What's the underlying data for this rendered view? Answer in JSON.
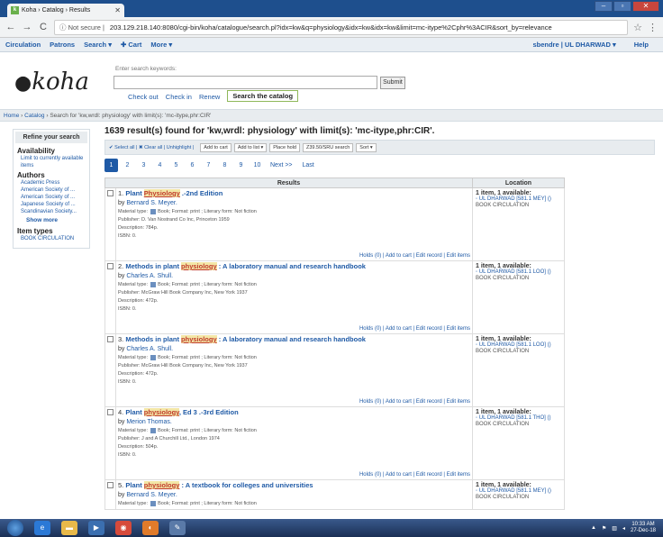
{
  "browser": {
    "tab_title": "Koha › Catalog › Results",
    "favicon_letter": "k",
    "security": "Not secure",
    "url": "203.129.218.140:8080/cgi-bin/koha/catalogue/search.pl?idx=kw&q=physiology&idx=kw&idx=kw&limit=mc-itype%2Cphr%3ACIR&sort_by=relevance"
  },
  "nav": {
    "items": [
      "Circulation",
      "Patrons",
      "Search ▾",
      "✚ Cart",
      "More ▾"
    ],
    "user": "sbendre | UL DHARWAD ▾",
    "help": "Help"
  },
  "header": {
    "logo": "koha",
    "search_label": "Enter search keywords:",
    "search_value": "",
    "submit": "Submit",
    "tabs": [
      "Check out",
      "Check in",
      "Renew",
      "Search the catalog"
    ]
  },
  "breadcrumb": {
    "home": "Home",
    "catalog": "Catalog",
    "current": "Search for 'kw,wrdl: physiology' with limit(s): 'mc-itype,phr:CIR'"
  },
  "sidebar": {
    "refine": "Refine your search",
    "availability_h": "Availability",
    "availability_items": [
      "Limit to currently available",
      "items"
    ],
    "authors_h": "Authors",
    "authors": [
      "Academic Press",
      "American Society of ...",
      "American Society of ...",
      "Japanese Society of ...",
      "Scandinavian Society..."
    ],
    "show_more": "Show more",
    "itemtypes_h": "Item types",
    "itemtypes": [
      "BOOK CIRCULATION"
    ]
  },
  "results": {
    "title": "1639 result(s) found for 'kw,wrdl: physiology' with limit(s): 'mc-itype,phr:CIR'.",
    "toolbar": {
      "select": "✔ Select all | ✖ Clear all | Unhighlight |",
      "add_cart": "Add to cart",
      "add_list": "Add to list ▾",
      "hold": "Place hold",
      "z3950": "Z39.50/SRU search",
      "sort": "Sort ▾"
    },
    "pages": [
      "1",
      "2",
      "3",
      "4",
      "5",
      "6",
      "7",
      "8",
      "9",
      "10",
      "Next >>",
      "Last"
    ],
    "col_results": "Results",
    "col_location": "Location",
    "actions": "Holds (0) | Add to cart | Edit record | Edit items",
    "records": [
      {
        "num": "1.",
        "pre": "Plant ",
        "hl": "Physiology",
        "post": " .-2nd Edition",
        "by": "Bernard S. Meyer.",
        "type": "Book; Format: print ; Literary form: Not fiction",
        "pub": "Publisher: D. Van Nostrand Co Inc, Princeton 1959",
        "desc": "Description: 784p.",
        "isbn": "ISBN: 0.",
        "avail": "1 item, 1 available:",
        "call": "UL DHARWAD [581.1 MEY] ()",
        "coll": "BOOK CIRCULATION"
      },
      {
        "num": "2.",
        "pre": "Methods in plant ",
        "hl": "physiology",
        "post": " : A laboratory manual and research handbook",
        "by": "Charles A. Shull.",
        "type": "Book; Format: print ; Literary form: Not fiction",
        "pub": "Publisher: McGraw Hill Book Company Inc, New York 1937",
        "desc": "Description: 472p.",
        "isbn": "ISBN: 0.",
        "avail": "1 item, 1 available:",
        "call": "UL DHARWAD [581.1 LOO] ()",
        "coll": "BOOK CIRCULATION"
      },
      {
        "num": "3.",
        "pre": "Methods in plant ",
        "hl": "physiology",
        "post": " : A laboratory manual and research handbook",
        "by": "Charles A. Shull.",
        "type": "Book; Format: print ; Literary form: Not fiction",
        "pub": "Publisher: McGraw Hill Book Company Inc, New York 1937",
        "desc": "Description: 472p.",
        "isbn": "ISBN: 0.",
        "avail": "1 item, 1 available:",
        "call": "UL DHARWAD [581.1 LOO] ()",
        "coll": "BOOK CIRCULATION"
      },
      {
        "num": "4.",
        "pre": "Plant ",
        "hl": "physiology",
        "post": ", Ed 3 .-3rd Edition",
        "by": "Merion Thomas.",
        "type": "Book; Format: print ; Literary form: Not fiction",
        "pub": "Publisher: J and A Churchill Ltd., London 1974",
        "desc": "Description: 504p.",
        "isbn": "ISBN: 0.",
        "avail": "1 item, 1 available:",
        "call": "UL DHARWAD [581.1 THO] ()",
        "coll": "BOOK CIRCULATION"
      },
      {
        "num": "5.",
        "pre": "Plant ",
        "hl": "physiology",
        "post": " : A textbook for colleges and universities",
        "by": "Bernard S. Meyer.",
        "type": "Book; Format: print ; Literary form: Not fiction",
        "pub": "",
        "desc": "",
        "isbn": "",
        "avail": "1 item, 1 available:",
        "call": "UL DHARWAD [581.1 MEY] ()",
        "coll": "BOOK CIRCULATION"
      }
    ]
  },
  "taskbar": {
    "time": "10:33 AM",
    "date": "27-Dec-18"
  }
}
